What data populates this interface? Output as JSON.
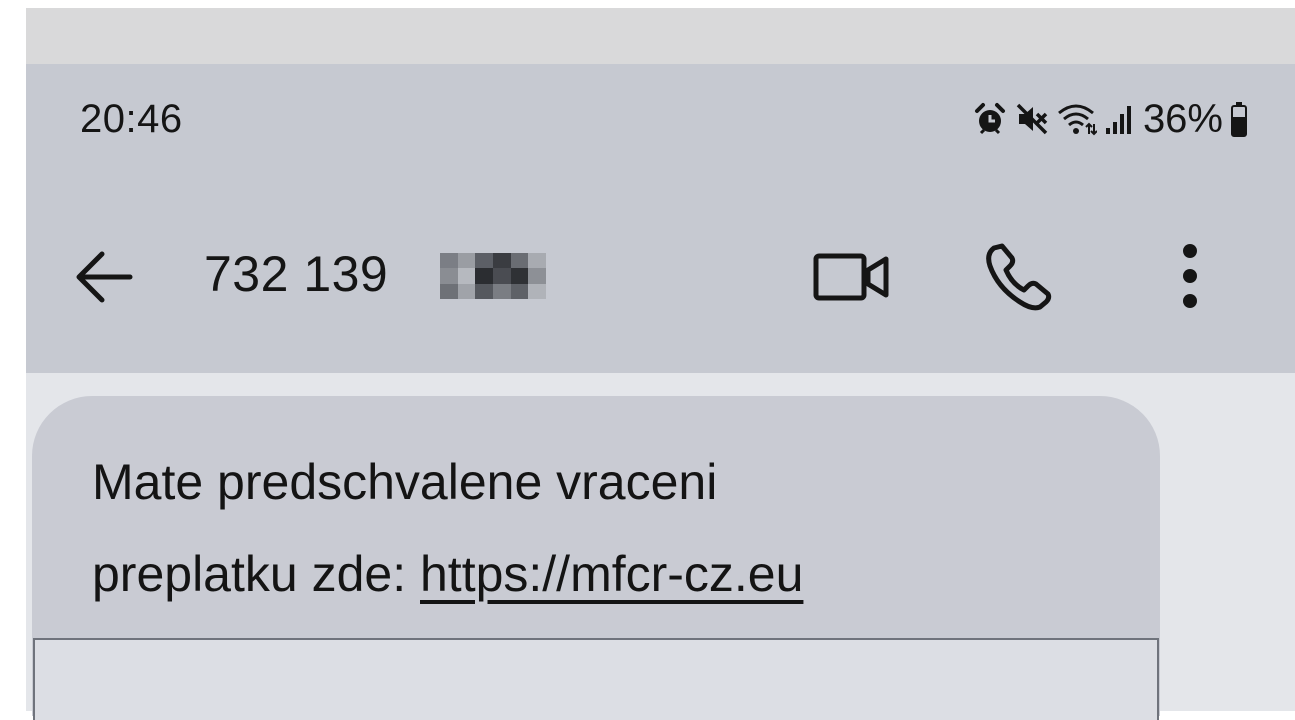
{
  "status_bar": {
    "time": "20:46",
    "icons": [
      "alarm-icon",
      "mute-icon",
      "wifi-icon",
      "signal-icon"
    ],
    "battery": "36%"
  },
  "app_bar": {
    "contact": "732 139",
    "actions": [
      "back-arrow-icon",
      "video-call-icon",
      "phone-icon",
      "more-options-icon"
    ]
  },
  "message": {
    "line1": "Mate predschvalene vraceni",
    "line2_prefix": "preplatku zde:",
    "link": "https://mfcr-cz.eu"
  },
  "colors": {
    "app_bar": "#c6c9d1",
    "bubble": "#c9cbd3",
    "background": "#e4e6ea",
    "text": "#151515"
  }
}
